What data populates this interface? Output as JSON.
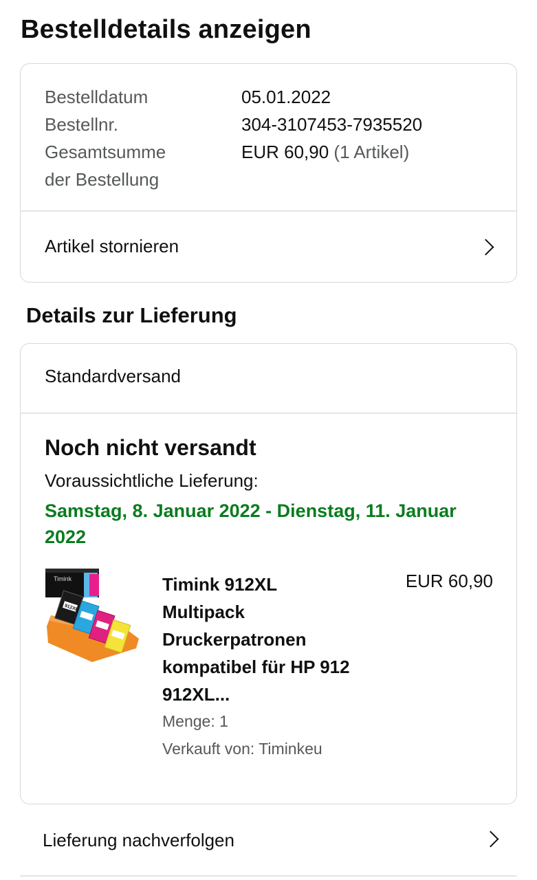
{
  "page": {
    "title": "Bestelldetails anzeigen"
  },
  "order_summary": {
    "rows": [
      {
        "label": "Bestelldatum",
        "value": "05.01.2022"
      },
      {
        "label": "Bestellnr.",
        "value": "304-3107453-7935520"
      }
    ],
    "total_label_line1": "Gesamtsumme",
    "total_label_line2": "der Bestellung",
    "total_value": "EUR 60,90",
    "total_items": "(1 Artikel)",
    "cancel_label": "Artikel stornieren"
  },
  "delivery": {
    "section_title": "Details zur Lieferung",
    "shipping_method": "Standardversand",
    "status": "Noch nicht versandt",
    "eta_label": "Voraussichtliche Lieferung:",
    "eta_date": "Samstag, 8. Januar 2022 - Dienstag, 11. Januar 2022",
    "item": {
      "title": "Timink 912XL Multipack Druckerpatronen kompatibel für HP 912 912XL...",
      "price": "EUR 60,90",
      "quantity": "Menge: 1",
      "seller": "Verkauft von: Timinkeu",
      "image_brand": "Timink",
      "image_label": "912XL"
    },
    "track_label": "Lieferung nachverfolgen"
  },
  "colors": {
    "eta_green": "#0a7c1f",
    "muted_text": "#565959",
    "border": "#d5d9d9"
  },
  "icons": {
    "chevron": "chevron-right-icon"
  }
}
